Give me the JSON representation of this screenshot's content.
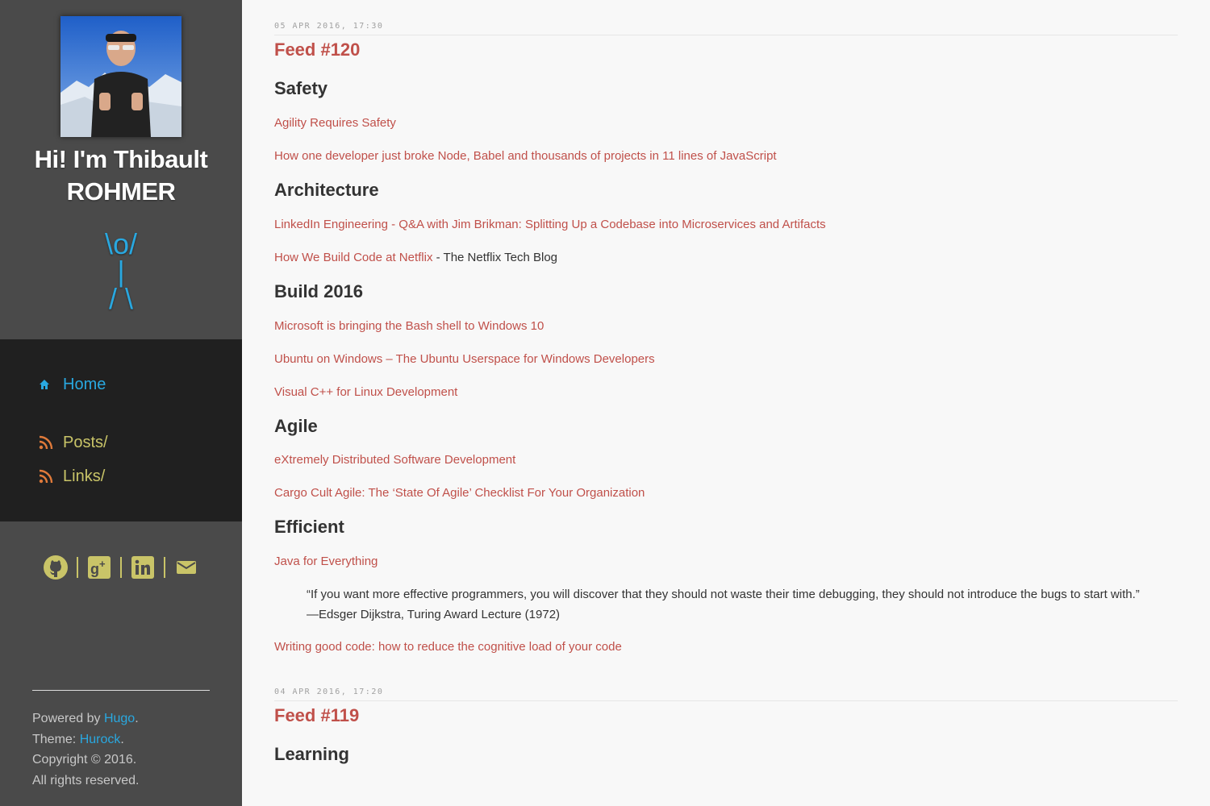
{
  "sidebar": {
    "greeting": "Hi! I'm Thibault ROHMER",
    "ascii_art": "\\o/\n|\n/ \\",
    "nav": [
      {
        "label": "Home",
        "icon": "home-icon"
      },
      {
        "label": "Posts/",
        "icon": "rss-icon"
      },
      {
        "label": "Links/",
        "icon": "rss-icon"
      }
    ],
    "social": [
      "github-icon",
      "google-plus-icon",
      "linkedin-icon",
      "mail-icon"
    ],
    "footer": {
      "powered_prefix": "Powered by ",
      "powered_link": "Hugo",
      "theme_prefix": "Theme: ",
      "theme_link": "Hurock",
      "copyright": "Copyright © 2016.",
      "rights": "All rights reserved."
    }
  },
  "colors": {
    "accent_blue": "#29a8e0",
    "accent_olive": "#c9c468",
    "link_red": "#c0504a",
    "sidebar_bg": "#4a4a4a",
    "nav_bg": "#202020"
  },
  "posts": [
    {
      "date": "05 APR 2016, 17:30",
      "title": "Feed #120",
      "sections": [
        {
          "heading": "Safety",
          "links": [
            {
              "text": "Agility Requires Safety"
            },
            {
              "text": "How one developer just broke Node, Babel and thousands of projects in 11 lines of JavaScript"
            }
          ]
        },
        {
          "heading": "Architecture",
          "links": [
            {
              "text": "LinkedIn Engineering - Q&A with Jim Brikman: Splitting Up a Codebase into Microservices and Artifacts"
            },
            {
              "text": "How We Build Code at Netflix",
              "suffix": " - The Netflix Tech Blog"
            }
          ]
        },
        {
          "heading": "Build 2016",
          "links": [
            {
              "text": "Microsoft is bringing the Bash shell to Windows 10"
            },
            {
              "text": "Ubuntu on Windows – The Ubuntu Userspace for Windows Developers"
            },
            {
              "text": "Visual C++ for Linux Development"
            }
          ]
        },
        {
          "heading": "Agile",
          "links": [
            {
              "text": "eXtremely Distributed Software Development"
            },
            {
              "text": "Cargo Cult Agile: The ‘State Of Agile’ Checklist For Your Organization"
            }
          ]
        },
        {
          "heading": "Efficient",
          "links": [
            {
              "text": "Java for Everything"
            }
          ],
          "quote": "“If you want more effective programmers, you will discover that they should not waste their time debugging, they should not introduce the bugs to start with.” —Edsger Dijkstra, Turing Award Lecture (1972)",
          "after_quote": "Writing good code: how to reduce the cognitive load of your code"
        }
      ]
    },
    {
      "date": "04 APR 2016, 17:20",
      "title": "Feed #119",
      "sections": [
        {
          "heading": "Learning"
        }
      ]
    }
  ]
}
